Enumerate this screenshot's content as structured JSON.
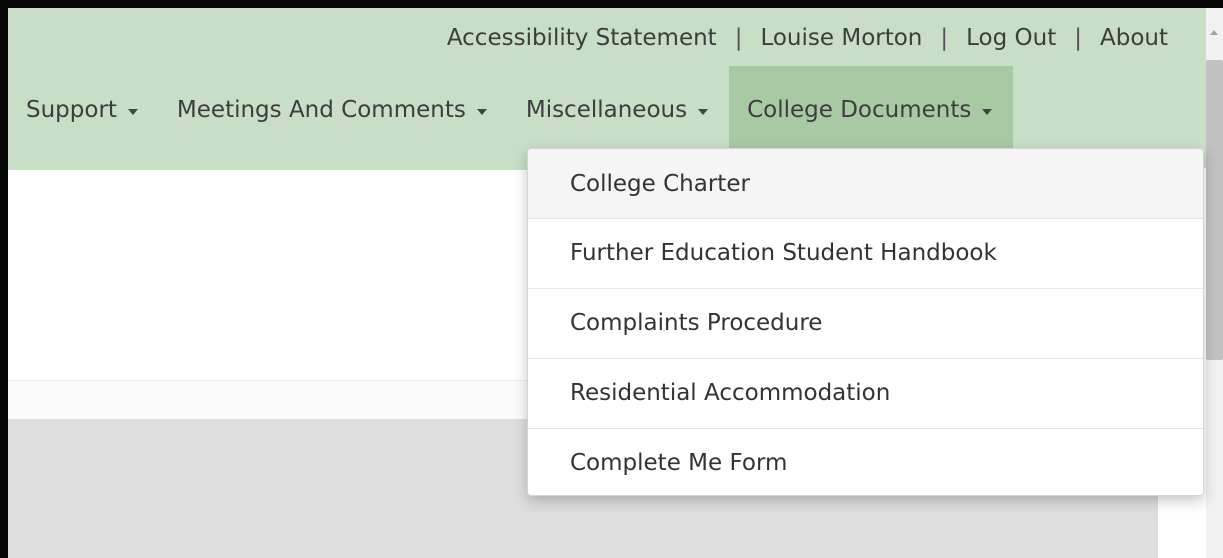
{
  "utility_nav": {
    "links": [
      "Accessibility Statement",
      "Louise Morton",
      "Log Out",
      "About"
    ],
    "separator": "|"
  },
  "main_nav": {
    "items": [
      {
        "label": "Support",
        "has_dropdown": true
      },
      {
        "label": "Meetings And Comments",
        "has_dropdown": true
      },
      {
        "label": "Miscellaneous",
        "has_dropdown": true
      },
      {
        "label": "College Documents",
        "has_dropdown": true,
        "expanded": true
      }
    ]
  },
  "dropdown": {
    "parent": "College Documents",
    "items": [
      {
        "label": "College Charter",
        "hovered": true
      },
      {
        "label": "Further Education Student Handbook"
      },
      {
        "label": "Complaints Procedure"
      },
      {
        "label": "Residential Accommodation"
      },
      {
        "label": "Complete Me Form"
      }
    ]
  },
  "colors": {
    "header_background": "#c9dec6",
    "active_nav_background": "#a9c9a5",
    "text": "#3d3d3d",
    "dropdown_hover": "#f5f5f5",
    "content_gray": "#dedede"
  },
  "icons": {
    "nav_caret": "caret-down-icon",
    "scroll_up": "arrow-up-icon"
  }
}
